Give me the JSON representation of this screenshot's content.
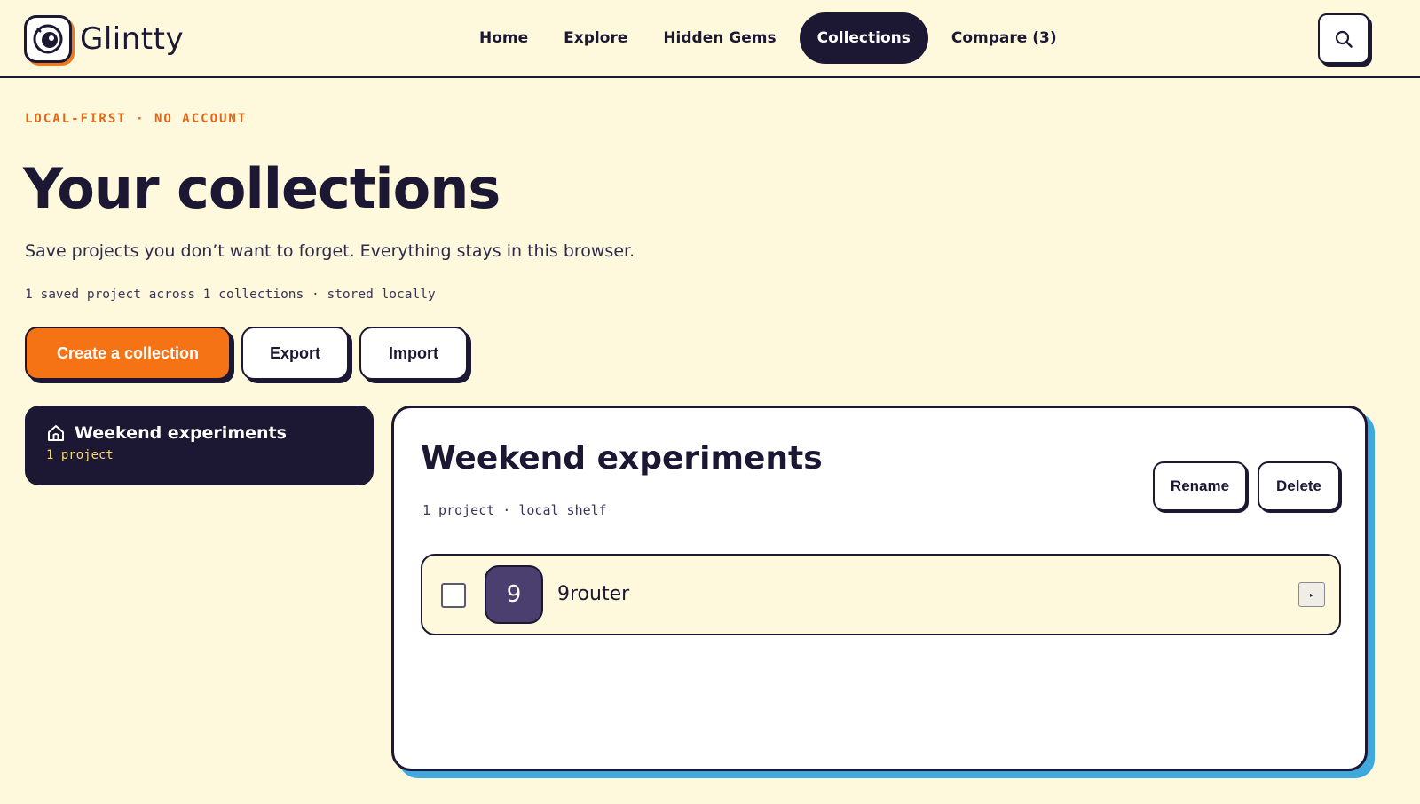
{
  "app": {
    "name": "Glintty",
    "accent": "#f57315",
    "ink": "#1c1733",
    "highlight": "#3fa9de"
  },
  "nav": {
    "items": [
      {
        "label": "Home"
      },
      {
        "label": "Explore"
      },
      {
        "label": "Hidden Gems"
      },
      {
        "label": "Collections"
      },
      {
        "label": "Compare (3)"
      }
    ],
    "active": "Collections",
    "search_icon": "search-icon"
  },
  "hero": {
    "eyebrow": "LOCAL-FIRST · NO ACCOUNT",
    "title": "Your collections",
    "subtitle": "Save projects you don’t want to forget. Everything stays in this browser.",
    "stats": "1 saved project across 1 collections · stored locally"
  },
  "actions": {
    "create_label": "Create a collection",
    "export_label": "Export",
    "import_label": "Import"
  },
  "sidebar": {
    "collections": [
      {
        "name": "Weekend experiments",
        "count": "1 project",
        "icon": "home-icon"
      }
    ]
  },
  "panel": {
    "title": "Weekend experiments",
    "meta": "1 project · local shelf",
    "rename_label": "Rename",
    "delete_label": "Delete",
    "projects": [
      {
        "avatar": "9",
        "name": "9router",
        "expand_glyph": "▸"
      }
    ]
  }
}
